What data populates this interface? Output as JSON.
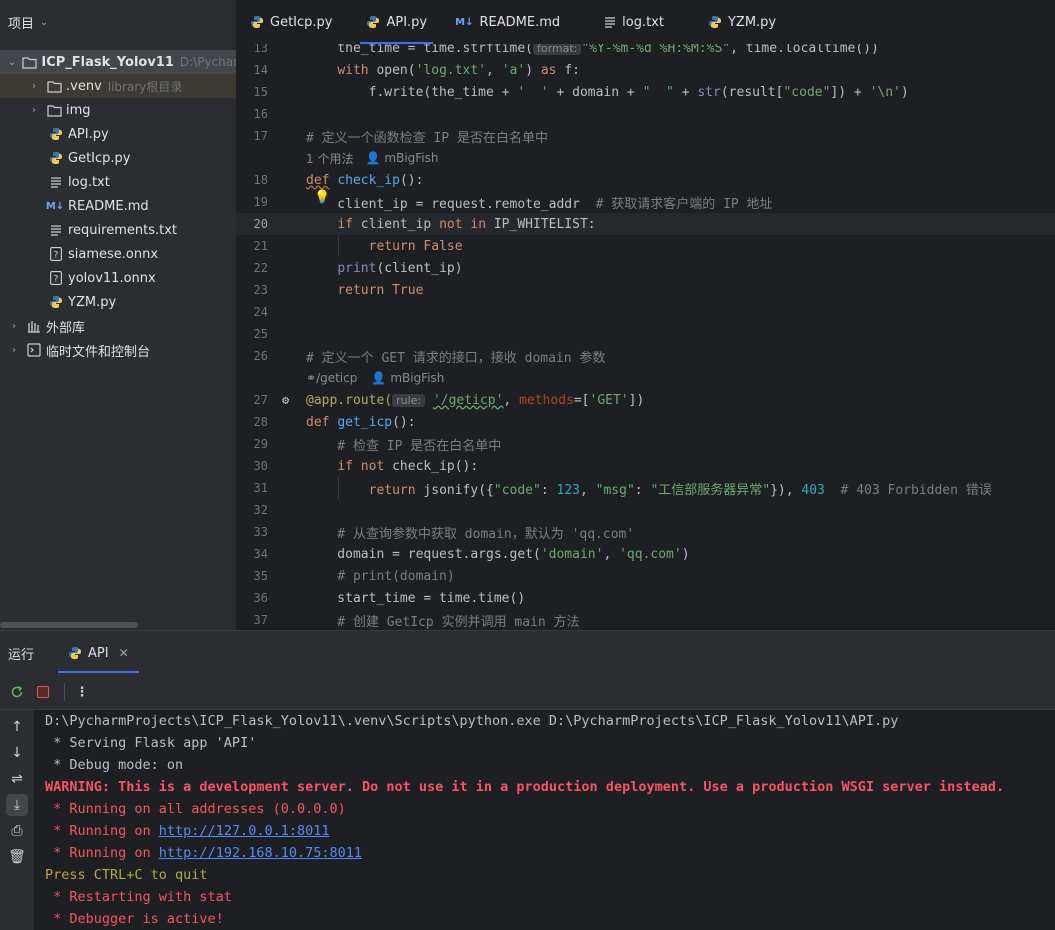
{
  "project": {
    "title": "项目",
    "root": {
      "name": "ICP_Flask_Yolov11",
      "path": "D:\\PycharmP"
    },
    "items": [
      {
        "name": ".venv",
        "hint": "library根目录",
        "type": "folder"
      },
      {
        "name": "img",
        "type": "folder"
      },
      {
        "name": "API.py",
        "type": "python"
      },
      {
        "name": "GetIcp.py",
        "type": "python"
      },
      {
        "name": "log.txt",
        "type": "text"
      },
      {
        "name": "README.md",
        "type": "md"
      },
      {
        "name": "requirements.txt",
        "type": "text"
      },
      {
        "name": "siamese.onnx",
        "type": "unknown"
      },
      {
        "name": "yolov11.onnx",
        "type": "unknown"
      },
      {
        "name": "YZM.py",
        "type": "python"
      },
      {
        "name": "外部库",
        "type": "library"
      },
      {
        "name": "临时文件和控制台",
        "type": "scratch"
      }
    ]
  },
  "tabs": [
    {
      "label": "GetIcp.py",
      "type": "python"
    },
    {
      "label": "API.py",
      "type": "python",
      "active": true
    },
    {
      "label": "README.md",
      "type": "md"
    },
    {
      "label": "log.txt",
      "type": "text"
    },
    {
      "label": "YZM.py",
      "type": "python"
    }
  ],
  "editor": {
    "line_numbers": [
      "13",
      "14",
      "15",
      "16",
      "17",
      "18",
      "19",
      "20",
      "21",
      "22",
      "23",
      "24",
      "25",
      "26",
      "27",
      "28",
      "29",
      "30",
      "31",
      "32",
      "33",
      "34",
      "35",
      "36",
      "37"
    ],
    "current_line": "20",
    "inlay_usages": "1 个用法",
    "inlay_author": "mBigFish",
    "inlay_route": "/geticp",
    "hint_format": "format:",
    "hint_rule": "rule:",
    "code": {
      "l13a": "    the_time = time.strftime(",
      "l13b": "\"%Y-%m-%d %H:%M:%S\"",
      "l13c": ", time.localtime())",
      "l14a": "    ",
      "l14kw": "with",
      "l14b": " open(",
      "l14s1": "'log.txt'",
      "l14c": ", ",
      "l14s2": "'a'",
      "l14d": ") ",
      "l14kw2": "as",
      "l14e": " f:",
      "l15a": "        f.write(the_time + ",
      "l15s1": "'  '",
      "l15b": " + domain + ",
      "l15s2": "\"  \"",
      "l15c": " + ",
      "l15bi": "str",
      "l15d": "(result[",
      "l15s3": "\"code\"",
      "l15e": "]) + ",
      "l15s4": "'\\n'",
      "l15f": ")",
      "l17": "# 定义一个函数检查 IP 是否在白名单中",
      "l18kw": "def",
      "l18fn": "check_ip",
      "l18b": "():",
      "l19a": "    client_ip = request.remote_addr  ",
      "l19c": "# 获取请求客户端的 IP 地址",
      "l20a": "    ",
      "l20kw": "if",
      "l20b": " client_ip ",
      "l20kw2": "not in",
      "l20c": " IP_WHITELIST:",
      "l21a": "        ",
      "l21kw": "return False",
      "l22a": "    ",
      "l22bi": "print",
      "l22b": "(client_ip)",
      "l23a": "    ",
      "l23kw": "return True",
      "l26": "# 定义一个 GET 请求的接口，接收 domain 参数",
      "l27a": "@app.route(",
      "l27s": "'/geticp'",
      "l27b": ", ",
      "l27p": "methods",
      "l27c": "=[",
      "l27s2": "'GET'",
      "l27d": "])",
      "l28kw": "def",
      "l28fn": "get_icp",
      "l28b": "():",
      "l29": "    # 检查 IP 是否在白名单中",
      "l30a": "    ",
      "l30kw": "if not",
      "l30b": " check_ip():",
      "l31a": "        ",
      "l31kw": "return",
      "l31b": " jsonify({",
      "l31s1": "\"code\"",
      "l31c": ": ",
      "l31n": "123",
      "l31d": ", ",
      "l31s2": "\"msg\"",
      "l31e": ": ",
      "l31s3": "\"工信部服务器异常\"",
      "l31f": "}), ",
      "l31n2": "403",
      "l31g": "  ",
      "l31cm": "# 403 Forbidden 错误",
      "l33": "    # 从查询参数中获取 domain，默认为 'qq.com'",
      "l34a": "    domain = request.args.get(",
      "l34s1": "'domain'",
      "l34b": ", ",
      "l34s2": "'qq.com'",
      "l34c": ")",
      "l35": "    # print(domain)",
      "l36": "    start_time = time.time()",
      "l37": "    # 创建 GetIcp 实例并调用 main 方法"
    }
  },
  "run": {
    "title": "运行",
    "tab_label": "API",
    "console": {
      "l1": "D:\\PycharmProjects\\ICP_Flask_Yolov11\\.venv\\Scripts\\python.exe D:\\PycharmProjects\\ICP_Flask_Yolov11\\API.py",
      "l2": " * Serving Flask app 'API'",
      "l3": " * Debug mode: on",
      "l4": "WARNING: This is a development server. Do not use it in a production deployment. Use a production WSGI server instead.",
      "l5": " * Running on all addresses (0.0.0.0)",
      "l6a": " * Running on ",
      "l6url": "http://127.0.0.1:8011",
      "l7a": " * Running on ",
      "l7url": "http://192.168.10.75:8011",
      "l8": "Press CTRL+C to quit",
      "l9": " * Restarting with stat",
      "l10": " * Debugger is active!"
    }
  },
  "colors": {
    "accent": "#3574f0",
    "keyword": "#cf8e6d",
    "string": "#6aab73",
    "function": "#56a8f5",
    "error": "#f75464"
  }
}
